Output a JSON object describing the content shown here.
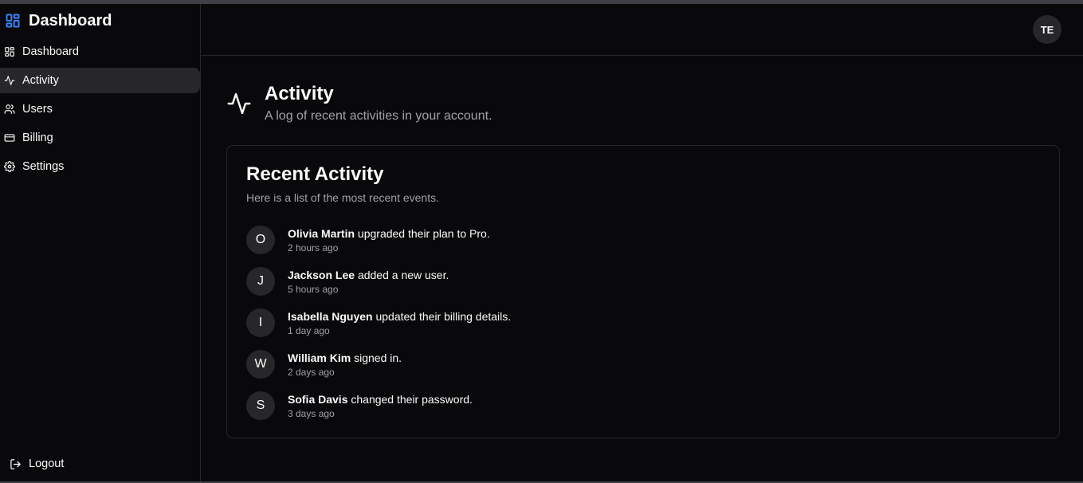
{
  "brand": {
    "title": "Dashboard",
    "accent": "#3b82f6"
  },
  "sidebar": {
    "items": [
      {
        "label": "Dashboard",
        "icon": "layout-grid-icon"
      },
      {
        "label": "Activity",
        "icon": "activity-icon",
        "active": true
      },
      {
        "label": "Users",
        "icon": "users-icon"
      },
      {
        "label": "Billing",
        "icon": "credit-card-icon"
      },
      {
        "label": "Settings",
        "icon": "gear-icon"
      }
    ],
    "logout_label": "Logout"
  },
  "header": {
    "avatar_initials": "TE"
  },
  "page": {
    "title": "Activity",
    "subtitle": "A log of recent activities in your account."
  },
  "card": {
    "title": "Recent Activity",
    "subtitle": "Here is a list of the most recent events.",
    "events": [
      {
        "initial": "O",
        "name": "Olivia Martin",
        "action": " upgraded their plan to Pro.",
        "time": "2 hours ago"
      },
      {
        "initial": "J",
        "name": "Jackson Lee",
        "action": " added a new user.",
        "time": "5 hours ago"
      },
      {
        "initial": "I",
        "name": "Isabella Nguyen",
        "action": " updated their billing details.",
        "time": "1 day ago"
      },
      {
        "initial": "W",
        "name": "William Kim",
        "action": " signed in.",
        "time": "2 days ago"
      },
      {
        "initial": "S",
        "name": "Sofia Davis",
        "action": " changed their password.",
        "time": "3 days ago"
      }
    ]
  }
}
